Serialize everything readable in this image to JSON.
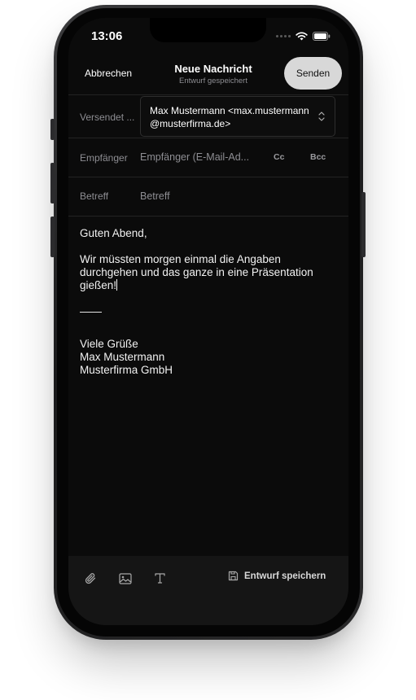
{
  "status_bar": {
    "time": "13:06"
  },
  "header": {
    "cancel_label": "Abbrechen",
    "title": "Neue Nachricht",
    "subtitle": "Entwurf gespeichert",
    "send_label": "Senden"
  },
  "fields": {
    "sender": {
      "label": "Versendet ...",
      "value": "Max Mustermann <max.mustermann@musterfirma.de>"
    },
    "recipient": {
      "label": "Empfänger",
      "placeholder": "Empfänger (E-Mail-Ad..."
    },
    "cc_label": "Cc",
    "bcc_label": "Bcc",
    "subject": {
      "label": "Betreff",
      "placeholder": "Betreff"
    }
  },
  "body": {
    "greeting": "Guten Abend,",
    "paragraph": "Wir müssten morgen einmal die Angaben durchgehen und das ganze in eine Präsentation gießen!",
    "separator": "——",
    "closing": "Viele Grüße",
    "sender_name": "Max Mustermann",
    "company": "Musterfirma GmbH"
  },
  "toolbar": {
    "icons": [
      "paperclip-icon",
      "image-icon",
      "text-format-icon",
      "save-icon"
    ],
    "save_draft_label": "Entwurf speichern"
  },
  "colors": {
    "screen_background": "#0b0b0b",
    "send_button": "#d8d8d8",
    "muted_text": "#8e8e93",
    "toolbar_background": "#151515"
  }
}
